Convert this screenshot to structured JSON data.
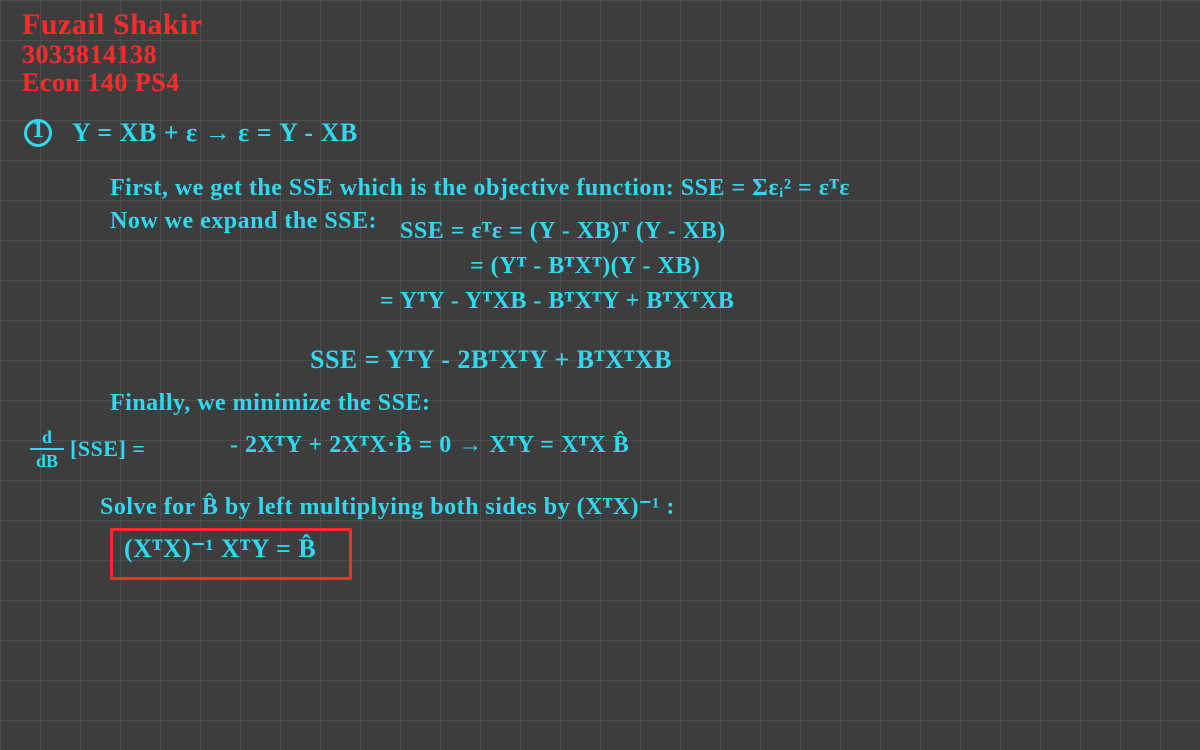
{
  "header": {
    "name": "Fuzail Shakir",
    "id": "3033814138",
    "course": "Econ 140 PS4"
  },
  "problem_number": "1",
  "lines": {
    "model": "Y = XB + ε  →  ε = Y - XB",
    "step1": "First, we get the SSE which is the objective function:  SSE = Σεᵢ² = εᵀε",
    "step2": "Now we expand the SSE:",
    "expand1": "SSE = εᵀε = (Y - XB)ᵀ (Y - XB)",
    "expand2": "= (Yᵀ - BᵀXᵀ)(Y - XB)",
    "expand3": "= YᵀY - YᵀXB - BᵀXᵀY + BᵀXᵀXB",
    "simplify": "SSE   =  YᵀY  -  2BᵀXᵀY  +  BᵀXᵀXB",
    "step3": "Finally, we minimize the SSE:",
    "deriv_label": "[SSE] =",
    "deriv_num": "d",
    "deriv_den": "dB",
    "deriv_rhs": "- 2XᵀY + 2XᵀX·B̂ = 0    →   XᵀY = XᵀX B̂",
    "step4": "Solve for B̂ by left multiplying both sides by (XᵀX)⁻¹ :",
    "result": "(XᵀX)⁻¹ XᵀY = B̂"
  }
}
